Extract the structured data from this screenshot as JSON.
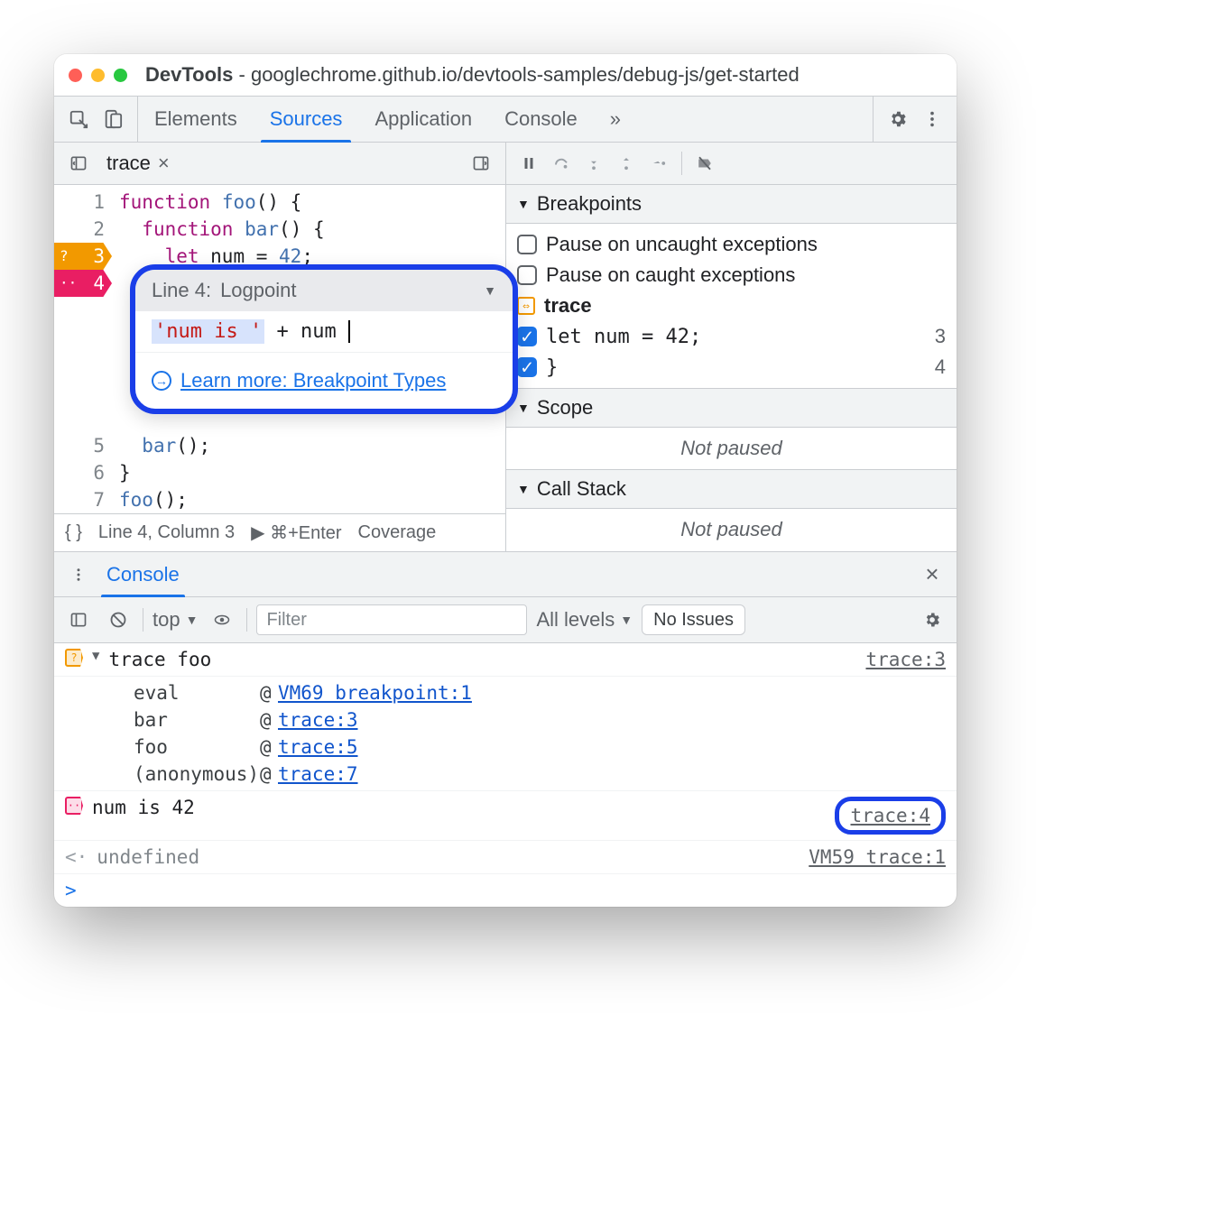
{
  "window": {
    "title_prefix": "DevTools",
    "title_url": "googlechrome.github.io/devtools-samples/debug-js/get-started"
  },
  "tabs": {
    "items": [
      "Elements",
      "Sources",
      "Application",
      "Console"
    ],
    "active": "Sources",
    "overflow": "»"
  },
  "file_tab": {
    "name": "trace",
    "close": "×"
  },
  "code": {
    "lines": [
      {
        "n": 1,
        "html": "function foo() {"
      },
      {
        "n": 2,
        "html": "  function bar() {"
      },
      {
        "n": 3,
        "html": "    let num = 42;",
        "bp": "orange",
        "bp_label": "?"
      },
      {
        "n": 4,
        "html": "  }",
        "bp": "pink",
        "bp_label": "··"
      },
      {
        "n": 5,
        "html": "  bar();"
      },
      {
        "n": 6,
        "html": "}"
      },
      {
        "n": 7,
        "html": "foo();"
      }
    ]
  },
  "logpoint": {
    "line_label": "Line 4:",
    "type": "Logpoint",
    "expr_string": "'num is '",
    "expr_concat": " + num",
    "learn_more": "Learn more: Breakpoint Types"
  },
  "statusbar": {
    "pretty": "{ }",
    "position": "Line 4, Column 3",
    "run": "▶ ⌘+Enter",
    "coverage": "Coverage"
  },
  "debugger": {
    "section_breakpoints": "Breakpoints",
    "pause_uncaught": "Pause on uncaught exceptions",
    "pause_caught": "Pause on caught exceptions",
    "script_name": "trace",
    "bps": [
      {
        "text": "let num = 42;",
        "line": "3",
        "checked": true
      },
      {
        "text": "}",
        "line": "4",
        "checked": true
      }
    ],
    "section_scope": "Scope",
    "section_callstack": "Call Stack",
    "not_paused": "Not paused"
  },
  "drawer": {
    "tab": "Console",
    "context": "top",
    "filter_placeholder": "Filter",
    "levels": "All levels",
    "issues": "No Issues"
  },
  "console": {
    "trace_header": "trace foo",
    "trace_header_src": "trace:3",
    "stack": [
      {
        "fn": "eval",
        "at": "VM69 breakpoint:1"
      },
      {
        "fn": "bar",
        "at": "trace:3"
      },
      {
        "fn": "foo",
        "at": "trace:5"
      },
      {
        "fn": "(anonymous)",
        "at": "trace:7"
      }
    ],
    "log_msg": "num is 42",
    "log_src": "trace:4",
    "return_val": "undefined",
    "return_src": "VM59 trace:1"
  }
}
